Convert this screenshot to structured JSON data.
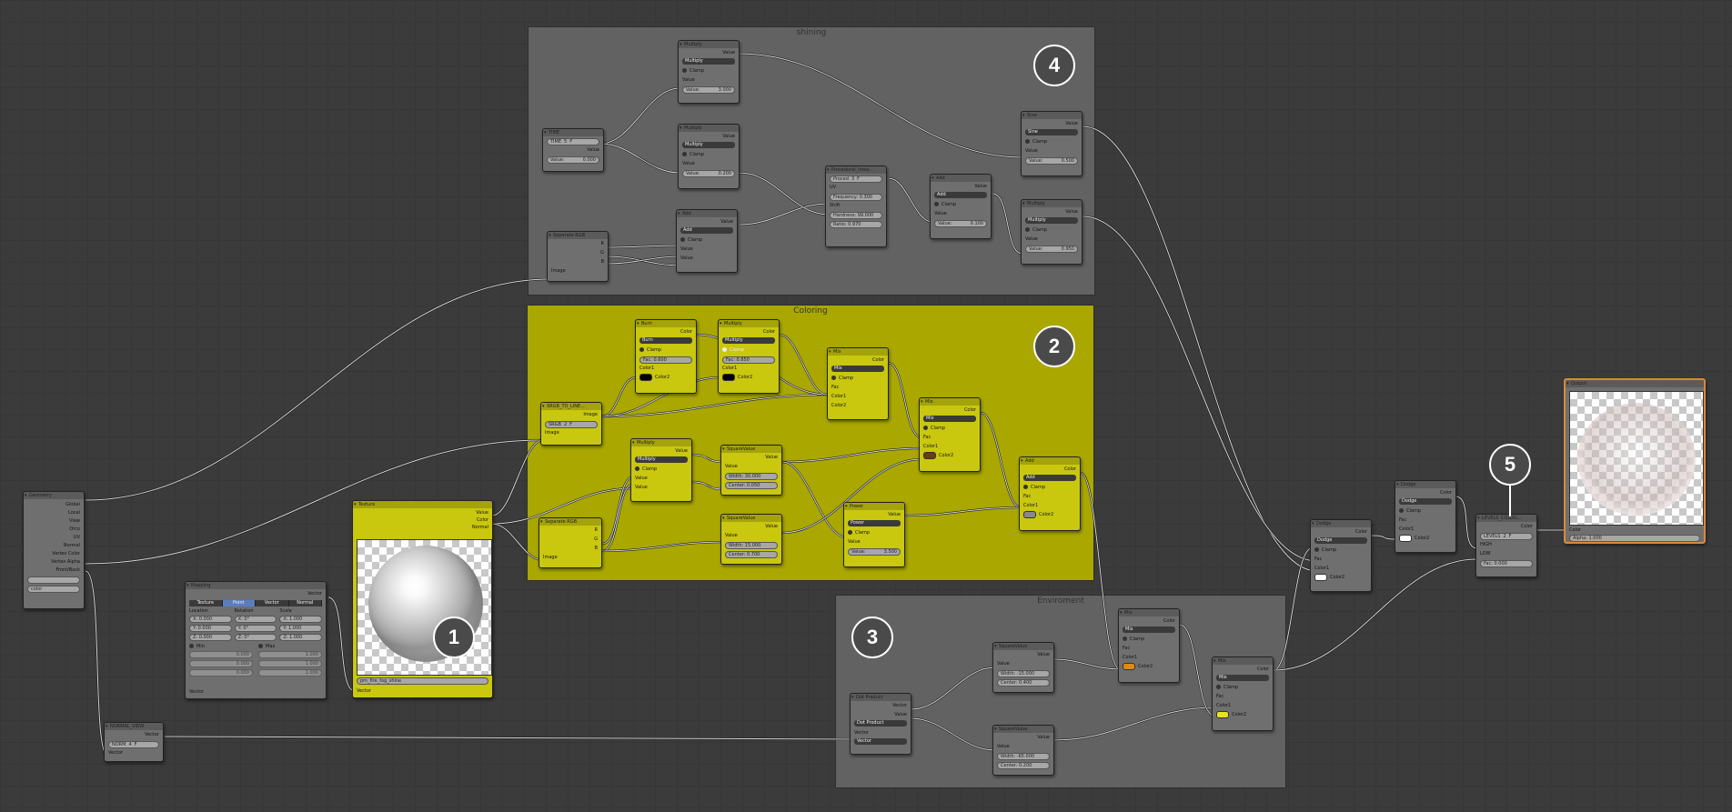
{
  "frames": {
    "shining": {
      "title": "shining",
      "num": "4"
    },
    "coloring": {
      "title": "Coloring",
      "num": "2"
    },
    "enviroment": {
      "title": "Enviroment",
      "num": "3"
    },
    "texture_num": "1",
    "levels_num": "5"
  },
  "colors": {
    "frame_gray": "#626262",
    "frame_yellow": "#a9a700",
    "node_yellow": "#c9c70e",
    "output_border": "#d98a3a"
  },
  "nodes": {
    "geometry": {
      "title": "Geometry",
      "outputs": [
        "Global",
        "Local",
        "View",
        "Orco",
        "UV",
        "Normal",
        "Vertex Color",
        "Vertex Alpha",
        "Front/Back"
      ],
      "field1": "",
      "field2": "color"
    },
    "mapping": {
      "title": "Mapping",
      "out": "Vector",
      "tabs": [
        "Texture",
        "Point",
        "Vector",
        "Normal"
      ],
      "col_loc": "Location",
      "col_rot": "Rotation",
      "col_scale": "Scale",
      "loc": [
        "X: 0.000",
        "Y: 0.000",
        "Z: 0.000"
      ],
      "rot": [
        "X: 0°",
        "Y: 0°",
        "Z: 0°"
      ],
      "scale": [
        "X: 1.000",
        "Y: 1.000",
        "Z: 1.000"
      ],
      "min": "Min",
      "max": "Max",
      "min_vals": [
        "0.000",
        "0.000",
        "0.000"
      ],
      "max_vals": [
        "1.000",
        "1.000",
        "1.000"
      ],
      "in": "Vector"
    },
    "normal_view": {
      "title": "NORMAL_VIEW",
      "out": "Vector",
      "sel": "NORM",
      "count": "4",
      "f": "F",
      "in": "Vector"
    },
    "texture": {
      "title": "Texture",
      "outs": [
        "Value",
        "Color",
        "Normal"
      ],
      "image": "pm_fire_fog_shine",
      "in": "Vector"
    },
    "time": {
      "title": "TIME",
      "out": "Value",
      "sel": "TIME",
      "count": "5",
      "f": "F",
      "val": "0.000"
    },
    "mul1": {
      "title": "Multiply",
      "out": "Value",
      "op": "Multiply",
      "clamp": "Clamp",
      "in": "Value",
      "val": "3.000"
    },
    "mul2": {
      "title": "Multiply",
      "out": "Value",
      "op": "Multiply",
      "clamp": "Clamp",
      "in": "Value",
      "val": "0.200"
    },
    "seprgb1": {
      "title": "Separate RGB",
      "outs": [
        "R",
        "G",
        "B"
      ],
      "in": "Image"
    },
    "add1": {
      "title": "Add",
      "out": "Value",
      "op": "Add",
      "clamp": "Clamp",
      "in1": "Value",
      "in2": "Value"
    },
    "proc": {
      "title": "Procedural_linea...",
      "sel": "Proced",
      "count": "3",
      "f": "F",
      "uv": "UV",
      "freq": "Frequency: 0.300",
      "shift": "Shift",
      "hard": "Hardness: 99.000",
      "ratio": "Ratio: 0.970"
    },
    "add2": {
      "title": "Add",
      "out": "Value",
      "op": "Add",
      "clamp": "Clamp",
      "in": "Value",
      "val": "0.100"
    },
    "sine": {
      "title": "Sine",
      "out": "Value",
      "op": "Sine",
      "clamp": "Clamp",
      "in": "Value",
      "val": "0.500"
    },
    "mul3": {
      "title": "Multiply",
      "out": "Value",
      "op": "Multiply",
      "clamp": "Clamp",
      "in": "Value",
      "val": "0.950"
    },
    "srgb": {
      "title": "SRGB_TO_LINE...",
      "out": "Image",
      "sel": "SRGB",
      "count": "2",
      "f": "F",
      "in": "Image"
    },
    "burn": {
      "title": "Burn",
      "out": "Color",
      "op": "Burn",
      "clamp": "Clamp",
      "fac": "Fac: 0.600",
      "c1": "Color1",
      "c2": "Color2"
    },
    "mulc": {
      "title": "Multiply",
      "out": "Color",
      "op": "Multiply",
      "clamp": "Clamp",
      "fac": "Fac: 0.850",
      "c1": "Color1",
      "c2": "Color2"
    },
    "mix1": {
      "title": "Mix",
      "out": "Color",
      "op": "Mix",
      "clamp": "Clamp",
      "fac": "Fac",
      "c1": "Color1",
      "c2": "Color2"
    },
    "mix2": {
      "title": "Mix",
      "out": "Color",
      "op": "Mix",
      "clamp": "Clamp",
      "fac": "Fac",
      "c1": "Color1",
      "c2": "Color2"
    },
    "mul4": {
      "title": "Multiply",
      "out": "Value",
      "op": "Multiply",
      "clamp": "Clamp",
      "in1": "Value",
      "in2": "Value"
    },
    "sq1": {
      "title": "SquareValue",
      "out": "Value",
      "in": "Value",
      "w": "Width: 30.000",
      "c": "Center: 0.050"
    },
    "seprgb2": {
      "title": "Separate RGB",
      "outs": [
        "R",
        "G",
        "B"
      ],
      "in": "Image"
    },
    "sq2": {
      "title": "SquareValue",
      "out": "Value",
      "in": "Value",
      "w": "Width: 15.000",
      "c": "Center: 0.700"
    },
    "power": {
      "title": "Power",
      "out": "Value",
      "op": "Power",
      "clamp": "Clamp",
      "in": "Value",
      "val": "3.500"
    },
    "addc": {
      "title": "Add",
      "out": "Color",
      "op": "Add",
      "clamp": "Clamp",
      "fac": "Fac",
      "c1": "Color1",
      "c2": "Color2"
    },
    "sq3": {
      "title": "SquareValue",
      "out": "Value",
      "in": "Value",
      "w": "Width: -15.000",
      "c": "Center: 0.400"
    },
    "mix3": {
      "title": "Mix",
      "out": "Color",
      "op": "Mix",
      "clamp": "Clamp",
      "fac": "Fac",
      "c1": "Color1",
      "c2": "Color2"
    },
    "dot": {
      "title": "Dot Product",
      "out1": "Vector",
      "out2": "Value",
      "op": "Dot Product",
      "in1": "Vector",
      "in2": "Vector"
    },
    "sq4": {
      "title": "SquareValue",
      "out": "Value",
      "in": "Value",
      "w": "Width: -65.000",
      "c": "Center: 0.200"
    },
    "mix4": {
      "title": "Mix",
      "out": "Color",
      "op": "Mix",
      "clamp": "Clamp",
      "fac": "Fac",
      "c1": "Color1",
      "c2": "Color2"
    },
    "dodge1": {
      "title": "Dodge",
      "out": "Color",
      "op": "Dodge",
      "clamp": "Clamp",
      "fac": "Fac",
      "c1": "Color1",
      "c2": "Color2"
    },
    "dodge2": {
      "title": "Dodge",
      "out": "Color",
      "op": "Dodge",
      "clamp": "Clamp",
      "fac": "Fac",
      "c1": "Color1",
      "c2": "Color2"
    },
    "levels": {
      "title": "LEVELS_COLOU...",
      "out": "Color",
      "sel": "LEVELS",
      "count": "2",
      "f": "F",
      "high": "HIGH",
      "low": "LOW",
      "fac": "Fac: 0.000"
    },
    "output": {
      "title": "Output",
      "color": "Color",
      "alpha": "Alpha: 1.000"
    }
  }
}
